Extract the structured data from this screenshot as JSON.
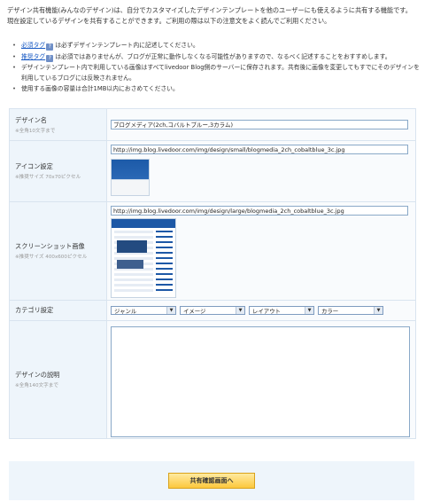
{
  "intro": "デザイン共有機能(みんなのデザイン)は、自分でカスタマイズしたデザインテンプレートを他のユーザーにも使えるように共有する機能です。現在設定しているデザインを共有することができます。ご利用の際は以下の注意文をよく読んでご利用ください。",
  "notes": [
    {
      "link": "必須タグ",
      "icon": "?",
      "text": "は必ずデザインテンプレート内に記述してください。"
    },
    {
      "link": "推奨タグ",
      "icon": "?",
      "text": "は必須ではありませんが、ブログが正常に動作しなくなる可能性がありますので、なるべく記述することをおすすめします。"
    },
    {
      "text": "デザインテンプレート内で利用している画像はすべてlivedoor Blog側のサーバーに保存されます。共有後に画像を変更してもすでにそのデザインを利用しているブログには反映されません。"
    },
    {
      "text": "使用する画像の容量は合計1MB以内におさめてください。"
    }
  ],
  "form": {
    "name": {
      "label": "デザイン名",
      "sub": "※全角10文字まで",
      "value": "ブログメディア(2ch,コバルトブルー,3カラム)"
    },
    "icon": {
      "label": "アイコン設定",
      "sub": "※推奨サイズ 70x70ピクセル",
      "value": "http://img.blog.livedoor.com/img/design/small/blogmedia_2ch_cobaltblue_3c.jpg"
    },
    "screenshot": {
      "label": "スクリーンショット画像",
      "sub": "※推奨サイズ 400x600ピクセル",
      "value": "http://img.blog.livedoor.com/img/design/large/blogmedia_2ch_cobaltblue_3c.jpg"
    },
    "category": {
      "label": "カテゴリ設定",
      "selects": [
        "ジャンル",
        "イメージ",
        "レイアウト",
        "カラー"
      ]
    },
    "description": {
      "label": "デザインの説明",
      "sub": "※全角140文字まで",
      "value": ""
    }
  },
  "submit": {
    "label": "共有確認画面へ"
  },
  "colors": {
    "accent": "#1a5bc4",
    "label_bg": "#eef5fb",
    "button": "#fcc83d"
  },
  "icons": {
    "help": "question-icon",
    "dropdown": "chevron-down-icon"
  }
}
